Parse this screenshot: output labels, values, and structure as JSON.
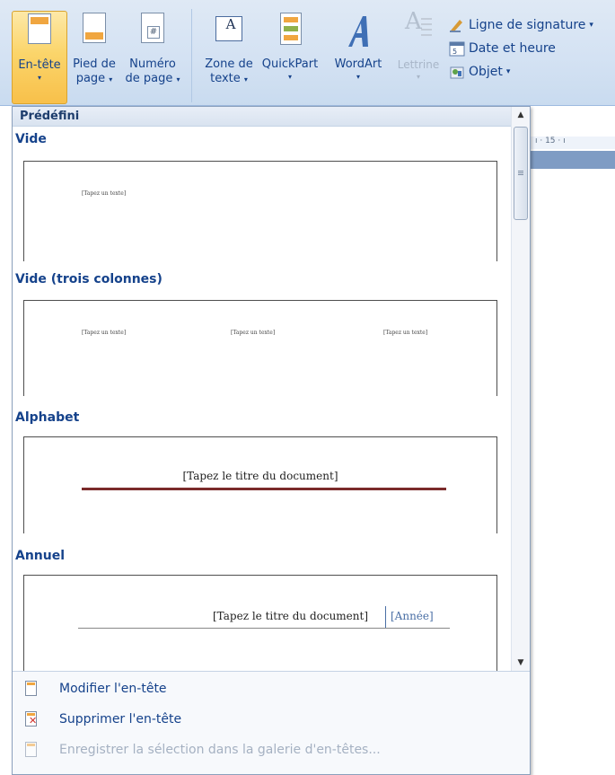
{
  "ribbon": {
    "buttons": [
      {
        "line1": "En-tête",
        "line2": "",
        "has_arrow": true
      },
      {
        "line1": "Pied de",
        "line2": "page",
        "has_arrow": true
      },
      {
        "line1": "Numéro",
        "line2": "de page",
        "has_arrow": true
      },
      {
        "line1": "Zone de",
        "line2": "texte",
        "has_arrow": true
      },
      {
        "line1": "QuickPart",
        "line2": "",
        "has_arrow": true
      },
      {
        "line1": "WordArt",
        "line2": "",
        "has_arrow": true
      },
      {
        "line1": "Lettrine",
        "line2": "",
        "has_arrow": true
      }
    ],
    "arrow_glyph": "▾",
    "small_items": [
      {
        "label": "Ligne de signature",
        "arrow": "▾"
      },
      {
        "label": "Date et heure",
        "arrow": ""
      },
      {
        "label": "Objet",
        "arrow": "▾"
      }
    ]
  },
  "ruler": {
    "text": "ı · 15 · ı"
  },
  "gallery": {
    "header": "Prédéfini",
    "sections": [
      {
        "title": "Vide",
        "placeholders": [
          "[Tapez un texte]"
        ]
      },
      {
        "title": "Vide (trois colonnes)",
        "placeholders": [
          "[Tapez un texte]",
          "[Tapez un texte]",
          "[Tapez un texte]"
        ]
      },
      {
        "title": "Alphabet",
        "doc_title": "[Tapez le titre du document]"
      },
      {
        "title": "Annuel",
        "doc_title": "[Tapez le titre du document]",
        "year": "[Année]"
      }
    ]
  },
  "scrollbar": {
    "up": "▲",
    "down": "▼"
  },
  "menu": {
    "items": [
      {
        "label": "Modifier l'en-tête",
        "enabled": true
      },
      {
        "label": "Supprimer l'en-tête",
        "enabled": true
      },
      {
        "label": "Enregistrer la sélection dans la galerie d'en-têtes...",
        "enabled": false
      }
    ]
  },
  "colors": {
    "ribbon_text": "#15428b",
    "active_button": "#fbd56b",
    "alphabet_line": "#7b2b2b",
    "annuel_year": "#4a6fa5"
  }
}
